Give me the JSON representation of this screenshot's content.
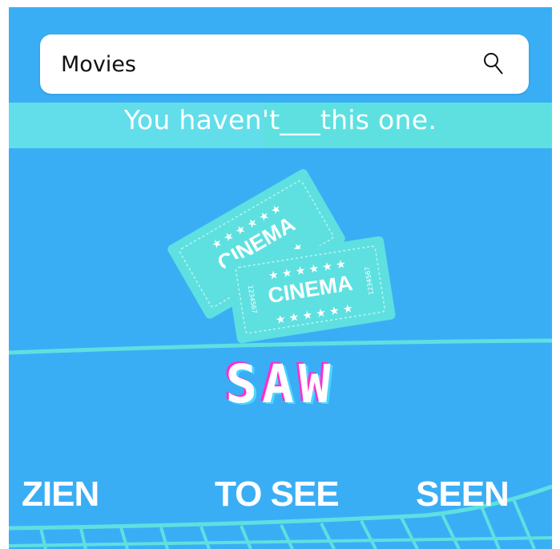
{
  "search": {
    "value": "Movies",
    "icon": "search-icon"
  },
  "banner": {
    "text": "You haven't___this one."
  },
  "tickets": {
    "label": "CINEMA",
    "number": "1234567",
    "icon": "cinema-tickets-icon"
  },
  "title": "SAW",
  "options": [
    "ZIEN",
    "TO SEE",
    "SEEN"
  ],
  "colors": {
    "background": "#3aaef5",
    "accent": "#5ee0e0",
    "title_shadow_pink": "#ff2fd0",
    "title_shadow_cyan": "#4ad6ff"
  }
}
